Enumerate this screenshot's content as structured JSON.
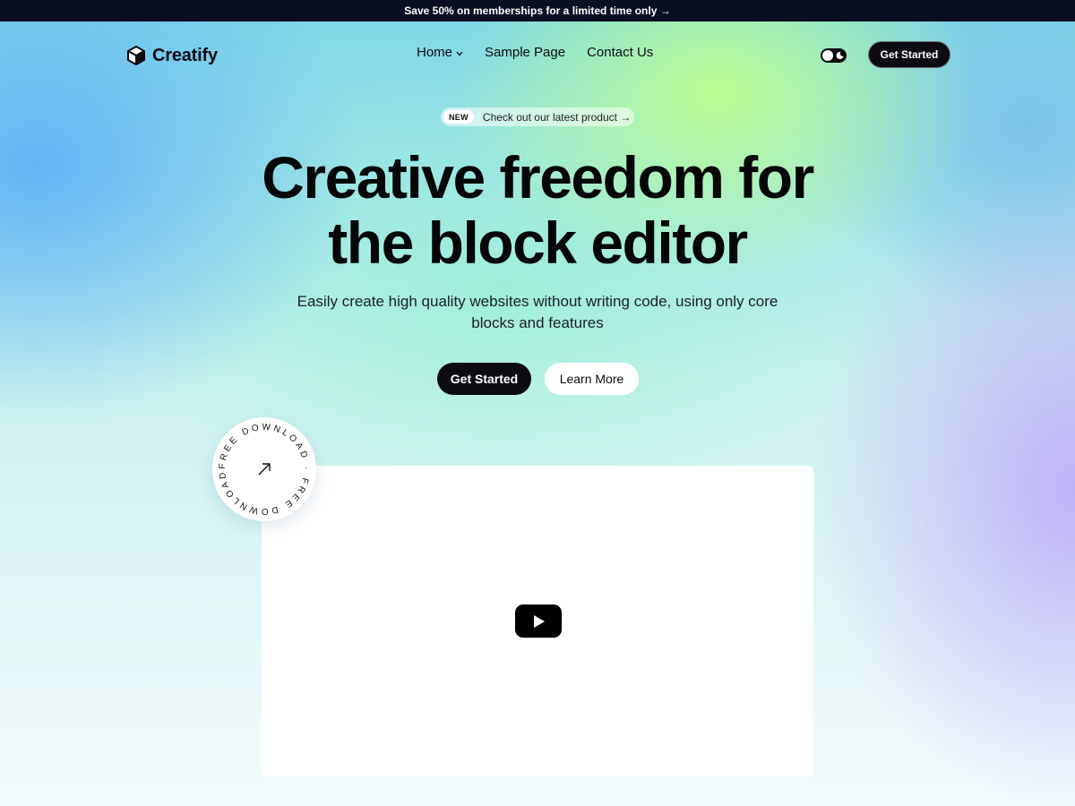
{
  "announcement": {
    "text": "Save 50% on memberships for a limited time only →"
  },
  "header": {
    "logo_text": "Creatify",
    "nav": [
      {
        "label": "Home",
        "has_dropdown": true
      },
      {
        "label": "Sample Page",
        "has_dropdown": false
      },
      {
        "label": "Contact Us",
        "has_dropdown": false
      }
    ],
    "cta_label": "Get Started"
  },
  "hero": {
    "pill_badge": "NEW",
    "pill_text": "Check out our latest product →",
    "title_line1": "Creative freedom for",
    "title_line2": "the block editor",
    "subtitle": "Easily create high quality websites without writing code, using only core blocks and features",
    "primary_button": "Get Started",
    "secondary_button": "Learn More"
  },
  "badge": {
    "ring_text": "FREE DOWNLOAD · FREE DOWNLOAD · "
  },
  "video": {
    "icon": "youtube-play-icon"
  },
  "colors": {
    "dark": "#0b0b12",
    "announce_bg": "#0a0e22",
    "white": "#ffffff"
  }
}
